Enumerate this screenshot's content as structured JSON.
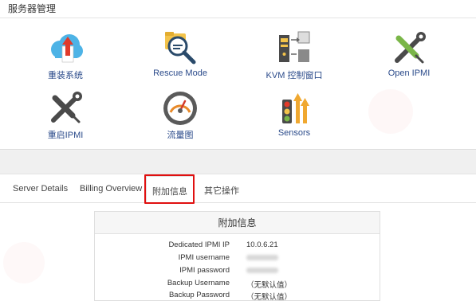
{
  "panel": {
    "title": "服务器管理",
    "tools": [
      {
        "label": "重装系统",
        "icon": "cloud-upload-icon"
      },
      {
        "label": "Rescue Mode",
        "icon": "folder-search-icon"
      },
      {
        "label": "KVM 控制窗口",
        "icon": "kvm-console-icon"
      },
      {
        "label": "Open IPMI",
        "icon": "wrench-screwdriver-icon"
      },
      {
        "label": "重启IPMI",
        "icon": "wrench-screwdriver-icon"
      },
      {
        "label": "流量图",
        "icon": "gauge-icon"
      },
      {
        "label": "Sensors",
        "icon": "sensors-icon"
      }
    ]
  },
  "tabs": [
    {
      "label": "Server Details"
    },
    {
      "label": "Billing Overview"
    },
    {
      "label": "附加信息",
      "active": true
    },
    {
      "label": "其它操作"
    }
  ],
  "info": {
    "title": "附加信息",
    "rows": [
      {
        "key": "Dedicated IPMI IP",
        "value": "10.0.6.21"
      },
      {
        "key": "IPMI username",
        "value": ""
      },
      {
        "key": "IPMI password",
        "value": ""
      },
      {
        "key": "Backup Username",
        "value": "（无默认值）"
      },
      {
        "key": "Backup Password",
        "value": "（无默认值）"
      }
    ]
  },
  "colors": {
    "highlight": "#e01010",
    "link": "#2a4a8a"
  }
}
